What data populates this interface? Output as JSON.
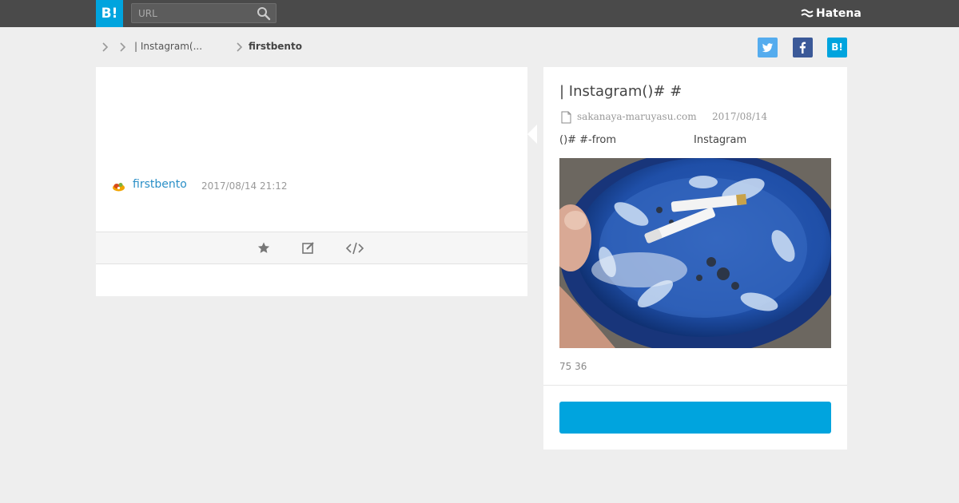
{
  "header": {
    "logo_text": "B!",
    "search_placeholder": "URL",
    "brand_name": "Hatena"
  },
  "breadcrumb": {
    "items": [
      "",
      "| Instagram(...",
      "firstbento"
    ]
  },
  "share": {
    "hatena_label": "B!"
  },
  "bookmark": {
    "username": "firstbento",
    "timestamp": "2017/08/14 21:12"
  },
  "entry": {
    "title": " | Instagram()# #",
    "domain": "sakanaya-maruyasu.com",
    "date": "2017/08/14",
    "summary_left": "()# #-from",
    "summary_right": "Instagram",
    "counts": "75 36",
    "button_label": ""
  },
  "colors": {
    "accent": "#00a4de",
    "topbar": "#4a4a4a",
    "link": "#2a8fc7",
    "twitter": "#55acee",
    "facebook": "#3b5998"
  }
}
